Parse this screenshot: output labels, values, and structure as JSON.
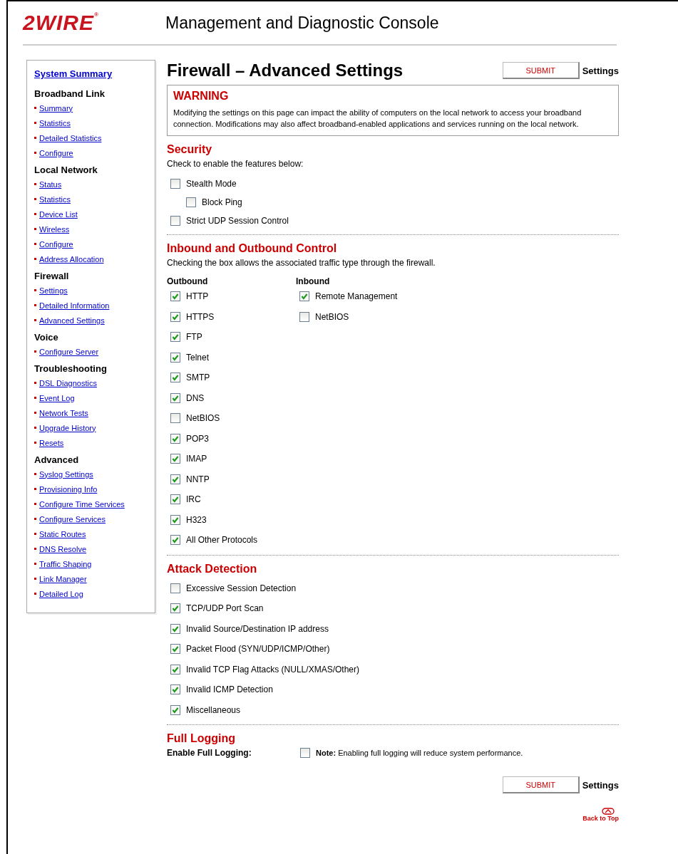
{
  "header": {
    "logo": "2WIRE",
    "logo_mark": "®",
    "title": "Management and Diagnostic Console"
  },
  "sidebar": {
    "top_link": "System Summary",
    "groups": [
      {
        "title": "Broadband Link",
        "links": [
          "Summary",
          "Statistics",
          "Detailed Statistics",
          "Configure"
        ]
      },
      {
        "title": "Local Network",
        "links": [
          "Status",
          "Statistics",
          "Device List",
          "Wireless",
          "Configure",
          "Address Allocation"
        ]
      },
      {
        "title": "Firewall",
        "links": [
          "Settings",
          "Detailed Information",
          "Advanced Settings"
        ]
      },
      {
        "title": "Voice",
        "links": [
          "Configure Server"
        ]
      },
      {
        "title": "Troubleshooting",
        "links": [
          "DSL Diagnostics",
          "Event Log",
          "Network Tests",
          "Upgrade History",
          "Resets"
        ]
      },
      {
        "title": "Advanced",
        "links": [
          "Syslog Settings",
          "Provisioning Info",
          "Configure Time Services",
          "Configure Services",
          "Static Routes",
          "DNS Resolve",
          "Traffic Shaping",
          "Link Manager",
          "Detailed Log"
        ]
      }
    ]
  },
  "page_title": "Firewall – Advanced Settings",
  "submit_top": {
    "button": "SUBMIT",
    "label": "Settings"
  },
  "warning": {
    "title": "WARNING",
    "text": "Modifying the settings on this page can impact the ability of computers on the local network to access your broadband connection. Modifications may also affect broadband-enabled applications and services running on the local network."
  },
  "security": {
    "title": "Security",
    "intro": "Check to enable the features below:",
    "items": [
      {
        "label": "Stealth Mode",
        "checked": false,
        "children": [
          {
            "label": "Block Ping",
            "checked": false
          }
        ]
      },
      {
        "label": "Strict UDP Session Control",
        "checked": false
      }
    ]
  },
  "traffic": {
    "title": "Inbound and Outbound Control",
    "intro": "Checking the box allows the associated traffic type through the firewall.",
    "columns": [
      {
        "heading": "Outbound",
        "items": [
          {
            "label": "HTTP",
            "checked": true
          },
          {
            "label": "HTTPS",
            "checked": true
          },
          {
            "label": "FTP",
            "checked": true
          },
          {
            "label": "Telnet",
            "checked": true
          },
          {
            "label": "SMTP",
            "checked": true
          },
          {
            "label": "DNS",
            "checked": true
          },
          {
            "label": "NetBIOS",
            "checked": false
          },
          {
            "label": "POP3",
            "checked": true
          },
          {
            "label": "IMAP",
            "checked": true
          },
          {
            "label": "NNTP",
            "checked": true
          },
          {
            "label": "IRC",
            "checked": true
          },
          {
            "label": "H323",
            "checked": true
          },
          {
            "label": "All Other Protocols",
            "checked": true
          }
        ]
      },
      {
        "heading": "Inbound",
        "items": [
          {
            "label": "Remote Management",
            "checked": true
          },
          {
            "label": "NetBIOS",
            "checked": false
          }
        ]
      }
    ]
  },
  "attack": {
    "title": "Attack Detection",
    "items": [
      {
        "label": "Excessive Session Detection",
        "checked": false
      },
      {
        "label": "TCP/UDP Port Scan",
        "checked": true
      },
      {
        "label": "Invalid Source/Destination IP address",
        "checked": true
      },
      {
        "label": "Packet Flood (SYN/UDP/ICMP/Other)",
        "checked": true
      },
      {
        "label": "Invalid TCP Flag Attacks (NULL/XMAS/Other)",
        "checked": true
      },
      {
        "label": "Invalid ICMP Detection",
        "checked": true
      },
      {
        "label": "Miscellaneous",
        "checked": true
      }
    ]
  },
  "logging": {
    "title": "Full Logging",
    "label": "Enable Full Logging:",
    "checked": false,
    "note": "**Note:** Enabling full logging will reduce system performance."
  },
  "submit_bottom": {
    "button": "SUBMIT",
    "label": "Settings"
  },
  "back_to_top": "Back to Top"
}
